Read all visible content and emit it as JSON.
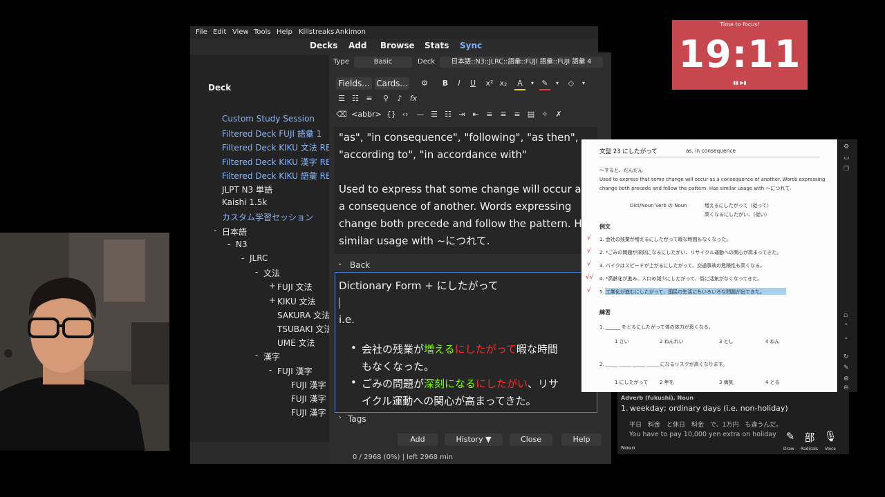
{
  "menu": [
    "File",
    "Edit",
    "View",
    "Tools",
    "Help",
    "Killstreaks",
    "Ankimon"
  ],
  "nav": [
    "Decks",
    "Add",
    "Browse",
    "Stats",
    "Sync"
  ],
  "deck_header": "Deck",
  "decks": [
    {
      "label": "Custom Study Session",
      "indent": 0,
      "style": "blue",
      "expander": ""
    },
    {
      "label": "Filtered Deck FUJI 語彙 1",
      "indent": 0,
      "style": "blue",
      "expander": ""
    },
    {
      "label": "Filtered Deck KIKU 文法 RED",
      "indent": 0,
      "style": "blue",
      "expander": ""
    },
    {
      "label": "Filtered Deck KIKU 漢字 RED",
      "indent": 0,
      "style": "blue",
      "expander": ""
    },
    {
      "label": "Filtered Deck KIKU 語彙 RED",
      "indent": 0,
      "style": "blue",
      "expander": ""
    },
    {
      "label": "JLPT N3 単語",
      "indent": 0,
      "style": "white",
      "expander": ""
    },
    {
      "label": "Kaishi 1.5k",
      "indent": 0,
      "style": "white",
      "expander": ""
    },
    {
      "label": "カスタム学習セッション",
      "indent": 0,
      "style": "blue",
      "expander": ""
    },
    {
      "label": "日本語",
      "indent": 0,
      "style": "white",
      "expander": "-"
    },
    {
      "label": "N3",
      "indent": 1,
      "style": "white",
      "expander": "-"
    },
    {
      "label": "JLRC",
      "indent": 2,
      "style": "white",
      "expander": "-"
    },
    {
      "label": "文法",
      "indent": 3,
      "style": "white",
      "expander": "-"
    },
    {
      "label": "FUJI 文法",
      "indent": 4,
      "style": "white",
      "expander": "+"
    },
    {
      "label": "KIKU 文法",
      "indent": 4,
      "style": "white",
      "expander": "+"
    },
    {
      "label": "SAKURA 文法",
      "indent": 4,
      "style": "white",
      "expander": ""
    },
    {
      "label": "TSUBAKI 文法",
      "indent": 4,
      "style": "white",
      "expander": ""
    },
    {
      "label": "UME 文法",
      "indent": 4,
      "style": "white",
      "expander": ""
    },
    {
      "label": "漢字",
      "indent": 3,
      "style": "white",
      "expander": "-"
    },
    {
      "label": "FUJI 漢字",
      "indent": 4,
      "style": "white",
      "expander": "-"
    },
    {
      "label": "FUJI 漢字",
      "indent": 5,
      "style": "white",
      "expander": ""
    },
    {
      "label": "FUJI 漢字",
      "indent": 5,
      "style": "white",
      "expander": ""
    },
    {
      "label": "FUJI 漢字",
      "indent": 5,
      "style": "white",
      "expander": ""
    }
  ],
  "add": {
    "type_label": "Type",
    "type_value": "Basic",
    "deck_label": "Deck",
    "deck_value": "日本語::N3::JLRC::語彙::FUJI 語彙::FUJI 語彙 4",
    "fields_btn": "Fields...",
    "cards_btn": "Cards...",
    "abbr": "<abbr>",
    "front_lines": [
      "\"as\", \"in consequence\", \"following\", \"as then\",",
      "\"according to\", \"in accordance with\"",
      "",
      "Used to express that some change will occur as",
      "a consequence of another. Words expressing",
      "change both precede and follow the pattern. Has",
      "similar usage with ~につれて."
    ],
    "back_label": "Back",
    "back_title": "Dictionary Form + にしたがって",
    "back_ie": "i.e.",
    "ex1_a": "会社の残業が",
    "ex1_b": "増える",
    "ex1_c": "にしたがって",
    "ex1_d": "暇な時間",
    "ex1_e": "もなくなった。",
    "ex2_a": "ごみの問題が",
    "ex2_b": "深刻になる",
    "ex2_c": "にしたがい",
    "ex2_d": "、リサ",
    "ex2_e": "イクル運動への関心が高まってきた。",
    "tags_label": "Tags",
    "buttons": [
      "Add",
      "History ▼",
      "Close",
      "Help"
    ],
    "status": "0 / 2968 (0%) | left 2968 min"
  },
  "timer": {
    "label": "Time to focus!",
    "time": "19:11",
    "controls": "▮▮ ▶▮"
  },
  "doc": {
    "header": "文型  23   にしたがって",
    "header_en": "as, in consequence",
    "l1": "～すると、だんだん",
    "l2": "Used to express that some change will occur as a consequence of another. Words expressing",
    "l3": "change both precede and follow the pattern. Has similar usage with ～につれて.",
    "l4": "Dict/Noun Verb の Noun",
    "l5": "増えるにしたがって（従って）",
    "l6": "高くなるにしたがい、（従い）",
    "reibun": "例文",
    "ex": [
      "1. 会社の残業が増えるにしたがって暇な時間もなくなった。",
      "2. *ごみの問題が深刻になるにしたがい、リサイクル運動への関心が高まってきた。",
      "3. バイクはスピードが上がるにしたがって、交通事故の危険性も高くなる。",
      "4. *高齢化が進み、人口の減少にしたがって、街に活気がなくなってきた。",
      "5. 工業化が進むにしたがって、国民の生活にもいろいろな問題が出てきた。"
    ],
    "renshu": "練習",
    "q1": "1. ______ をとるにしたがって体の体力が衰くなる。",
    "q1opts": [
      "1 さい",
      "2 ねんれい",
      "3 とし",
      "4 ねん"
    ],
    "q2": "2. _____ _____ _____ _____ になるリスクが高くなります。",
    "q2opts": [
      "1 にしたがって",
      "2 年を",
      "3 病気",
      "4 とる"
    ]
  },
  "dict": {
    "pos": "Adverb (fukushi), Noun",
    "def": "weekday; ordinary days (i.e. non-holiday)",
    "jp": "平日　料金　と休日　料金　で、1万円　も違うんだ。",
    "en": "You have to pay 10,000 yen extra on holiday",
    "pos2": "Noun",
    "tools": [
      "Draw",
      "Radicals",
      "Voice"
    ],
    "tool_glyphs": [
      "✎",
      "部",
      "🎙"
    ]
  }
}
